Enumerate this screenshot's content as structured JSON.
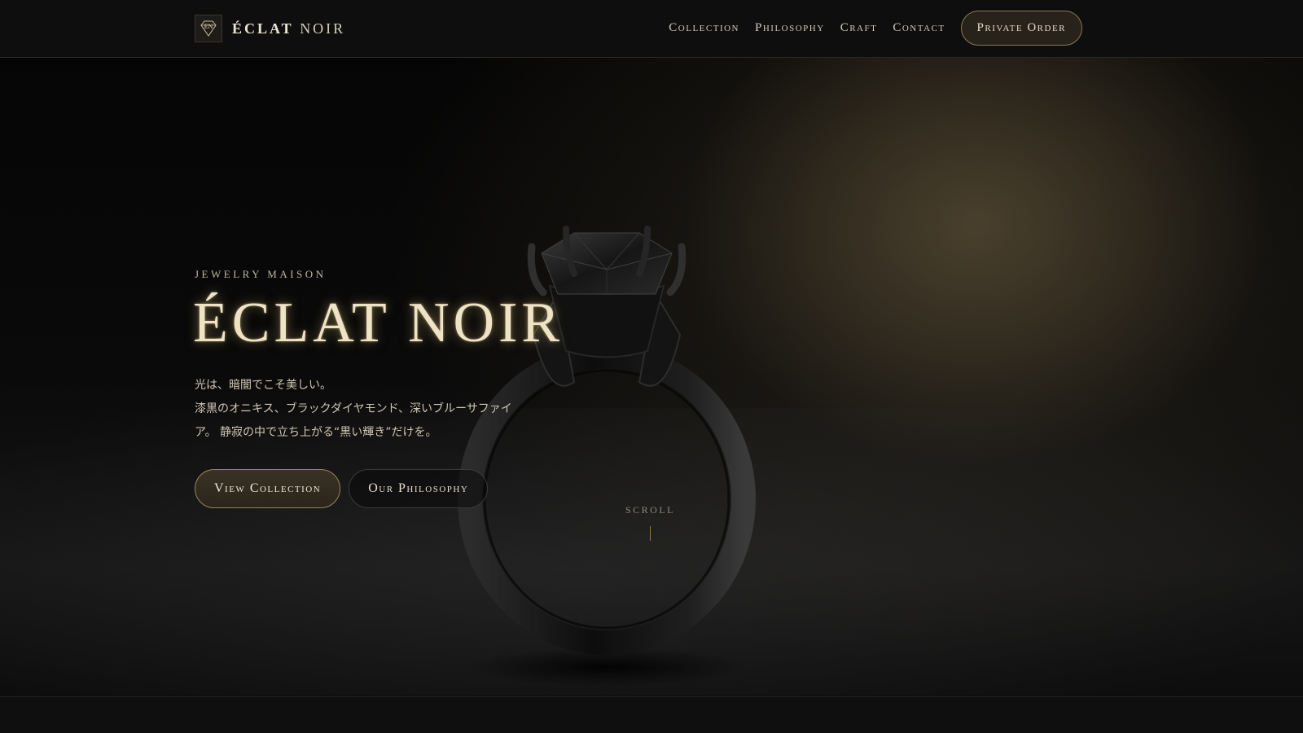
{
  "brand": {
    "mark": "EN",
    "name_strong": "ÉCLAT",
    "name_light": "NOIR"
  },
  "nav": {
    "items": [
      {
        "label": "Collection"
      },
      {
        "label": "Philosophy"
      },
      {
        "label": "Craft"
      },
      {
        "label": "Contact"
      }
    ],
    "cta_label": "Private Order"
  },
  "hero": {
    "eyebrow": "JEWELRY MAISON",
    "title": "ÉCLAT NOIR",
    "copy_lines": [
      "光は、暗闇でこそ美しい。",
      "漆黒のオニキス、ブラックダイヤモンド、深いブルーサファイ",
      "ア。 静寂の中で立ち上がる“黒い輝き”だけを。"
    ],
    "primary_button": "View Collection",
    "secondary_button": "Our Philosophy",
    "scroll_label": "SCROLL"
  },
  "colors": {
    "background": "#0c0c0c",
    "accent_gold": "#9a8458",
    "title_text": "#efe3c6"
  },
  "icons": {
    "logo": "diamond-icon",
    "hero_image": "black-ring-image"
  }
}
